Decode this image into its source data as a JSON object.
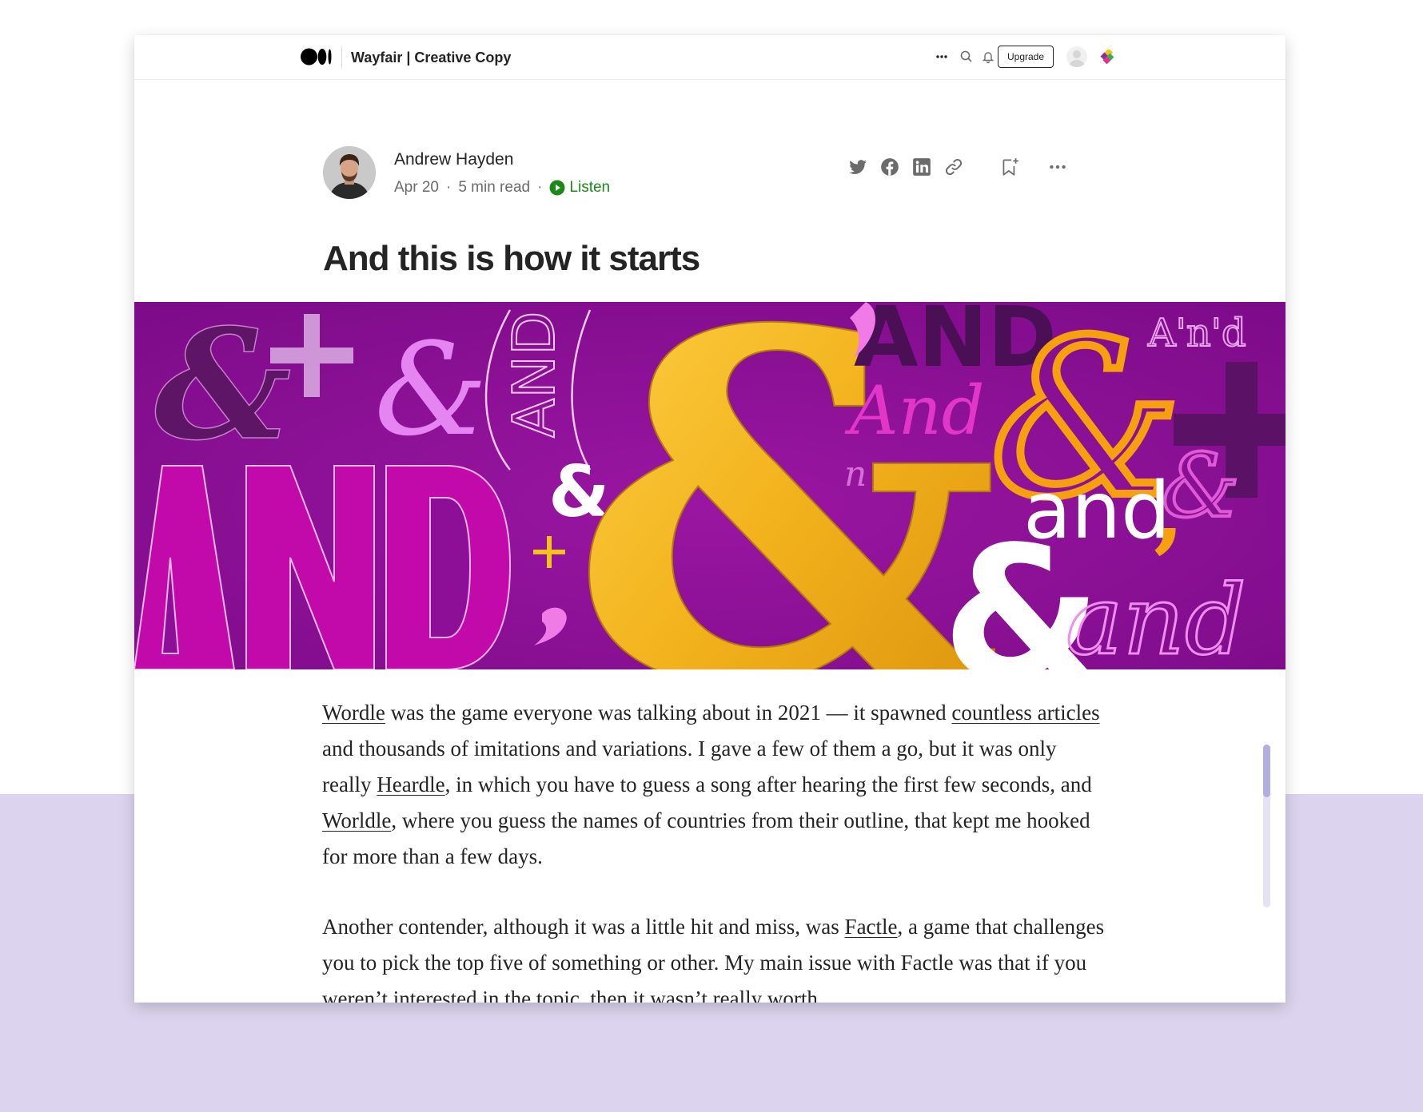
{
  "colors": {
    "page_background_lower": "#dcd4ee",
    "listen_green": "#1a8917",
    "hero_purple": "#8e0f97",
    "hero_gold": "#f3b51c",
    "hero_orange": "#f7a00f"
  },
  "topbar": {
    "publication": "Wayfair | Creative Copy",
    "upgrade_label": "Upgrade",
    "icons": [
      "medium-logo-icon",
      "more-dots-icon",
      "search-icon",
      "bell-icon",
      "user-avatar-icon",
      "publication-logo-icon"
    ]
  },
  "post": {
    "author": "Andrew Hayden",
    "date": "Apr 20",
    "sep1": "·",
    "read_time": "5 min read",
    "sep2": "·",
    "listen_label": "Listen",
    "title": "And this is how it starts",
    "share_icons": [
      "twitter-icon",
      "facebook-icon",
      "linkedin-icon",
      "copy-link-icon",
      "bookmark-icon",
      "more-icon"
    ]
  },
  "hero": {
    "alt_words": [
      "&",
      "+",
      "&",
      "AND",
      "&",
      "'AND",
      "A'n'd",
      "And",
      "&",
      "+",
      "AND",
      "&",
      "+",
      ",",
      "n",
      "and,",
      "&",
      "&",
      "and"
    ]
  },
  "article": {
    "p1": {
      "link1": "Wordle",
      "t1": " was the game everyone was talking about in 2021 — it spawned ",
      "link2": "countless articles",
      "t2": " and thousands of imitations and variations. I gave a few of them a go, but it was only really ",
      "link3": "Heardle",
      "t3": ", in which you have to guess a song after hearing the first few seconds, and ",
      "link4": "Worldle",
      "t4": ", where you guess the names of countries from their outline, that kept me hooked for more than a few days."
    },
    "p2": {
      "t1": "Another contender, although it was a little hit and miss, was ",
      "link1": "Factle",
      "t2": ", a game that challenges you to pick the top five of something or other. My main issue with Factle was that if you weren’t interested in the topic, then it wasn’t really worth"
    }
  }
}
